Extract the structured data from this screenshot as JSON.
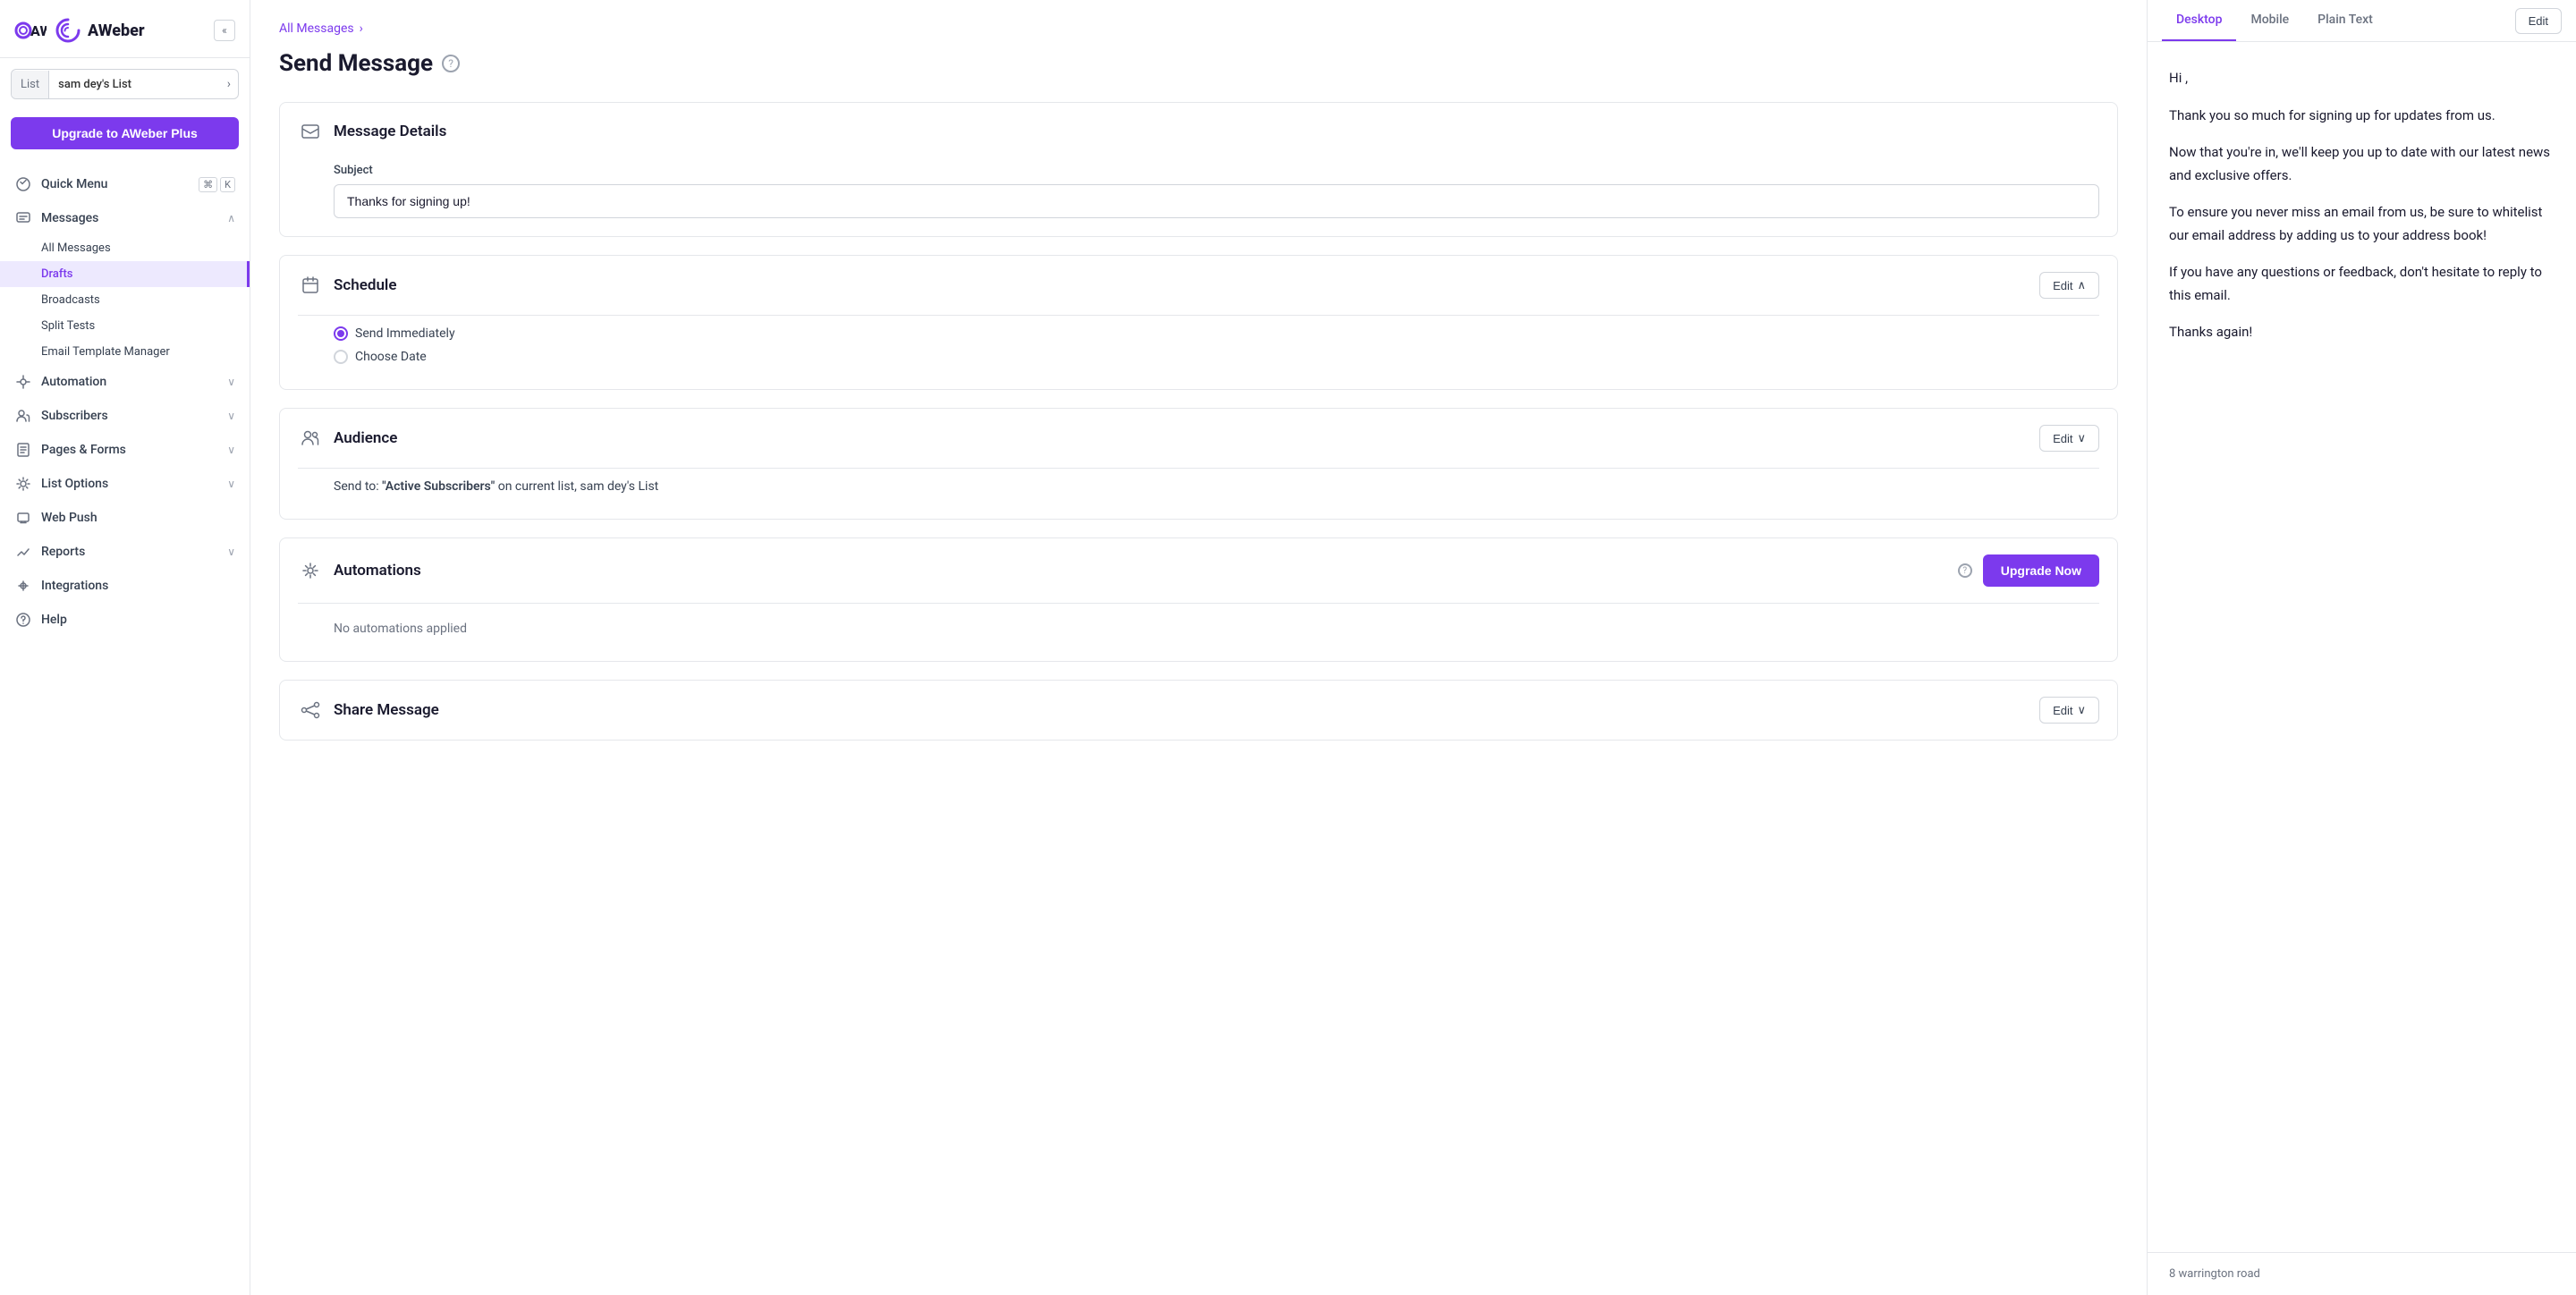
{
  "sidebar": {
    "logo_text": "AWeber",
    "collapse_icon": "«",
    "list_label": "List",
    "list_name": "sam dey's List",
    "upgrade_btn": "Upgrade to AWeber Plus",
    "nav_items": [
      {
        "id": "quick-menu",
        "label": "Quick Menu",
        "icon": "⚡",
        "shortcut": [
          "⌘",
          "K"
        ],
        "has_shortcut": true
      },
      {
        "id": "messages",
        "label": "Messages",
        "icon": "✉",
        "expanded": true
      },
      {
        "id": "automation",
        "label": "Automation",
        "icon": "🔄",
        "has_chevron": true
      },
      {
        "id": "subscribers",
        "label": "Subscribers",
        "icon": "👥",
        "has_chevron": true
      },
      {
        "id": "pages-forms",
        "label": "Pages & Forms",
        "icon": "📄",
        "has_chevron": true
      },
      {
        "id": "list-options",
        "label": "List Options",
        "icon": "⚙",
        "has_chevron": true
      },
      {
        "id": "web-push",
        "label": "Web Push",
        "icon": "🔔"
      },
      {
        "id": "reports",
        "label": "Reports",
        "icon": "📊",
        "has_chevron": true
      },
      {
        "id": "integrations",
        "label": "Integrations",
        "icon": "🔗"
      },
      {
        "id": "help",
        "label": "Help",
        "icon": "❓"
      }
    ],
    "messages_sub": [
      {
        "id": "all-messages",
        "label": "All Messages"
      },
      {
        "id": "drafts",
        "label": "Drafts",
        "active": true
      },
      {
        "id": "broadcasts",
        "label": "Broadcasts"
      },
      {
        "id": "split-tests",
        "label": "Split Tests"
      },
      {
        "id": "email-template-manager",
        "label": "Email Template Manager"
      }
    ]
  },
  "breadcrumb": {
    "parent": "All Messages",
    "separator": "›"
  },
  "page": {
    "title": "Send Message",
    "help_icon": "?"
  },
  "message_details": {
    "section_title": "Message Details",
    "subject_label": "Subject",
    "subject_value": "Thanks for signing up!"
  },
  "schedule": {
    "section_title": "Schedule",
    "edit_label": "Edit",
    "options": [
      {
        "id": "send-immediately",
        "label": "Send Immediately",
        "selected": true
      },
      {
        "id": "choose-date",
        "label": "Choose Date",
        "selected": false
      }
    ]
  },
  "audience": {
    "section_title": "Audience",
    "edit_label": "Edit",
    "send_to_text": "Send to: ",
    "send_to_highlight": "\"Active Subscribers\"",
    "send_to_suffix": " on current list, sam dey's List"
  },
  "automations": {
    "section_title": "Automations",
    "upgrade_btn": "Upgrade Now",
    "no_automations": "No automations applied"
  },
  "share_message": {
    "section_title": "Share Message",
    "edit_label": "Edit"
  },
  "preview": {
    "tabs": [
      "Desktop",
      "Mobile",
      "Plain Text"
    ],
    "active_tab": "Desktop",
    "edit_label": "Edit",
    "content": {
      "greeting": "Hi ,",
      "p1": "Thank you so much for signing up for updates from us.",
      "p2": "Now that you're in, we'll keep you up to date with our latest news and exclusive offers.",
      "p3": "To ensure you never miss an email from us, be sure to whitelist our email address by adding us to your address book!",
      "p4": "If you have any questions or feedback, don't hesitate to reply to this email.",
      "p5": "Thanks again!",
      "footer": "8 warrington road"
    }
  }
}
